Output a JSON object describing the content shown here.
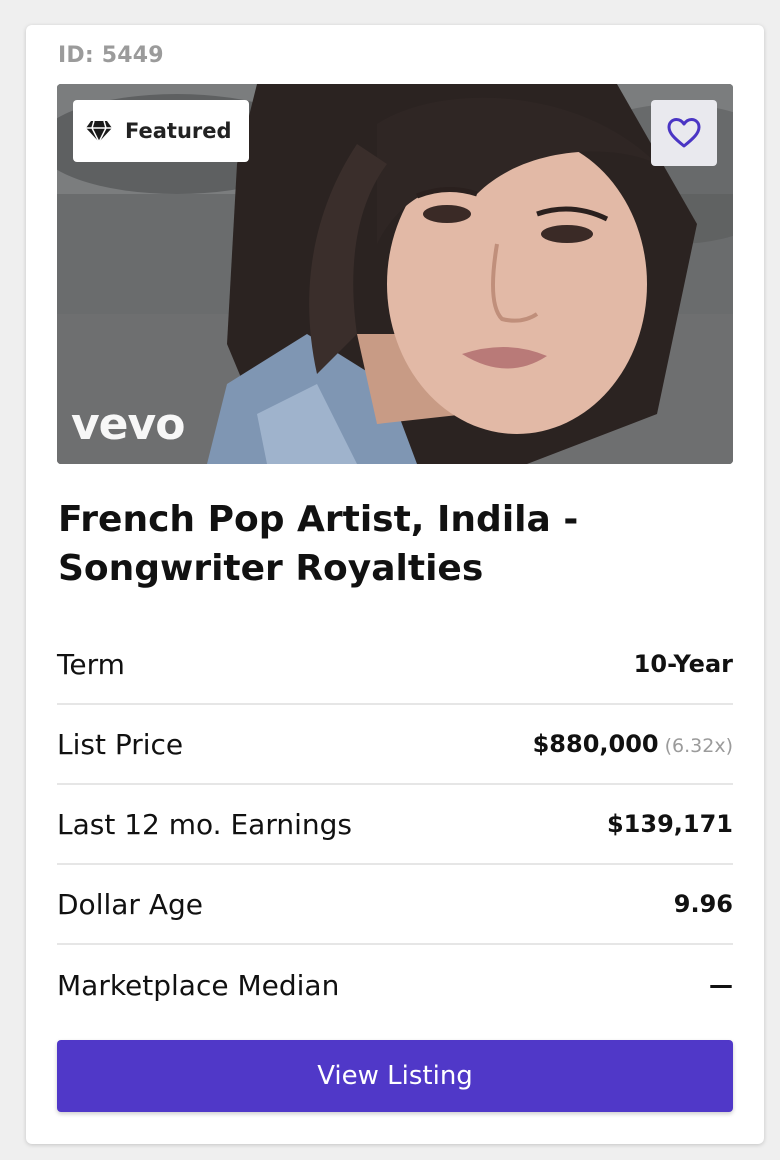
{
  "listing": {
    "id_label": "ID: 5449",
    "featured_label": "Featured",
    "watermark": "vevo",
    "title": "French Pop Artist, Indila - Songwriter Royalties",
    "favorite_icon": "heart-outline-icon",
    "featured_icon": "diamond-icon"
  },
  "stats": [
    {
      "label": "Term",
      "value": "10-Year",
      "sub": ""
    },
    {
      "label": "List Price",
      "value": "$880,000",
      "sub": "(6.32x)"
    },
    {
      "label": "Last 12 mo. Earnings",
      "value": "$139,171",
      "sub": ""
    },
    {
      "label": "Dollar Age",
      "value": "9.96",
      "sub": ""
    },
    {
      "label": "Marketplace Median",
      "value": "—",
      "sub": ""
    }
  ],
  "actions": {
    "view_label": "View Listing"
  },
  "colors": {
    "accent": "#5038c8",
    "muted": "#9b9b9b"
  }
}
